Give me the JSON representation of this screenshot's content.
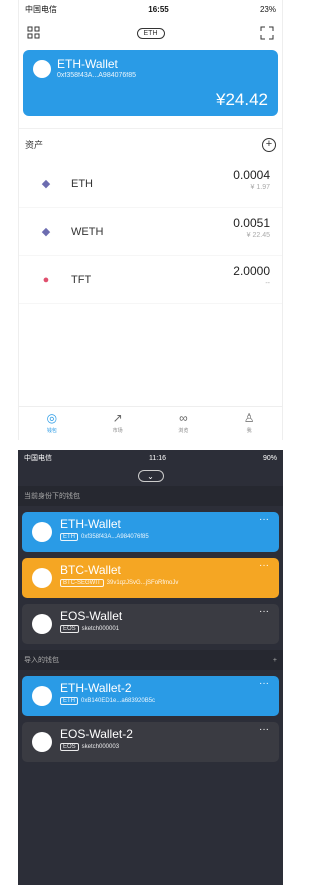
{
  "s1": {
    "status": {
      "carrier": "中国电信",
      "time": "16:55",
      "battery": "23%"
    },
    "chip": "ETH",
    "wallet": {
      "name": "ETH-Wallet",
      "address": "0xf358f43A...A984076f85",
      "balance": "¥24.42"
    },
    "assets_label": "资产",
    "assets": [
      {
        "symbol": "ETH",
        "amount": "0.0004",
        "value": "¥ 1.97"
      },
      {
        "symbol": "WETH",
        "amount": "0.0051",
        "value": "¥ 22.45"
      },
      {
        "symbol": "TFT",
        "amount": "2.0000",
        "value": "--"
      }
    ],
    "tabs": [
      "钱包",
      "市场",
      "浏览",
      "我"
    ]
  },
  "s2": {
    "status": {
      "carrier": "中国电信",
      "time": "11:16",
      "battery": "90%"
    },
    "group1": "当前身份下的钱包",
    "group2": "导入的钱包",
    "wallets": [
      {
        "name": "ETH-Wallet",
        "tag": "ETH",
        "addr": "0xf358f43A...A984076f85",
        "color": "#2a9be6"
      },
      {
        "name": "BTC-Wallet",
        "tag": "BTC-SEGWIT",
        "addr": "39v1qzJSvG...jSFoRfmoJv",
        "color": "#f5a623"
      },
      {
        "name": "EOS-Wallet",
        "tag": "EOS",
        "addr": "sketch000001",
        "color": "#3a3b42"
      },
      {
        "name": "ETH-Wallet-2",
        "tag": "ETH",
        "addr": "0xB140ED1e...a683920B5c",
        "color": "#2a9be6"
      },
      {
        "name": "EOS-Wallet-2",
        "tag": "EOS",
        "addr": "sketch000003",
        "color": "#3a3b42"
      }
    ]
  }
}
